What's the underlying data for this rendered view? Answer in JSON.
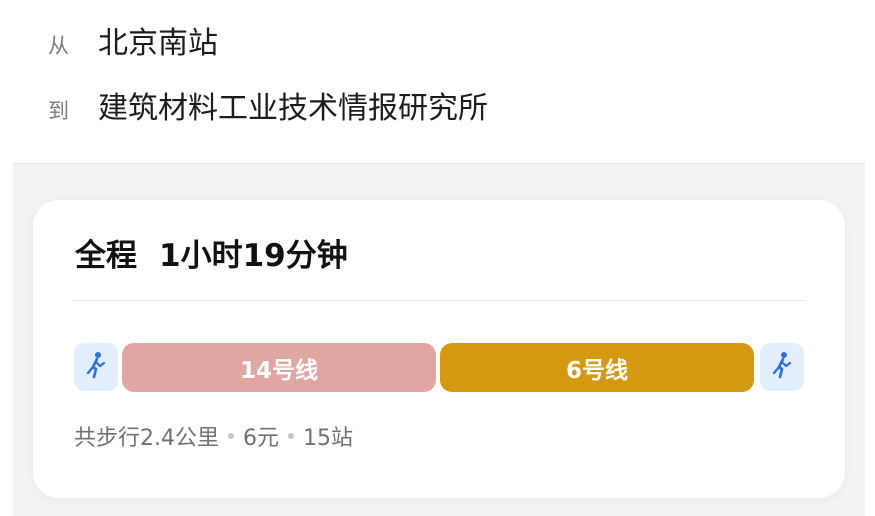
{
  "origin": {
    "tag": "从",
    "name": "北京南站"
  },
  "destination": {
    "tag": "到",
    "name": "建筑材料工业技术情报研究所"
  },
  "route": {
    "total_label": "全程",
    "duration": "1小时19分钟",
    "segments": [
      {
        "type": "walk",
        "icon": "walk-icon"
      },
      {
        "type": "subway",
        "label": "14号线",
        "color": "#e2a6a2"
      },
      {
        "type": "subway",
        "label": "6号线",
        "color": "#d5990f"
      },
      {
        "type": "walk",
        "icon": "walk-icon"
      }
    ],
    "summary": {
      "walk": "共步行2.4公里",
      "fare": "6元",
      "stops": "15站"
    }
  }
}
